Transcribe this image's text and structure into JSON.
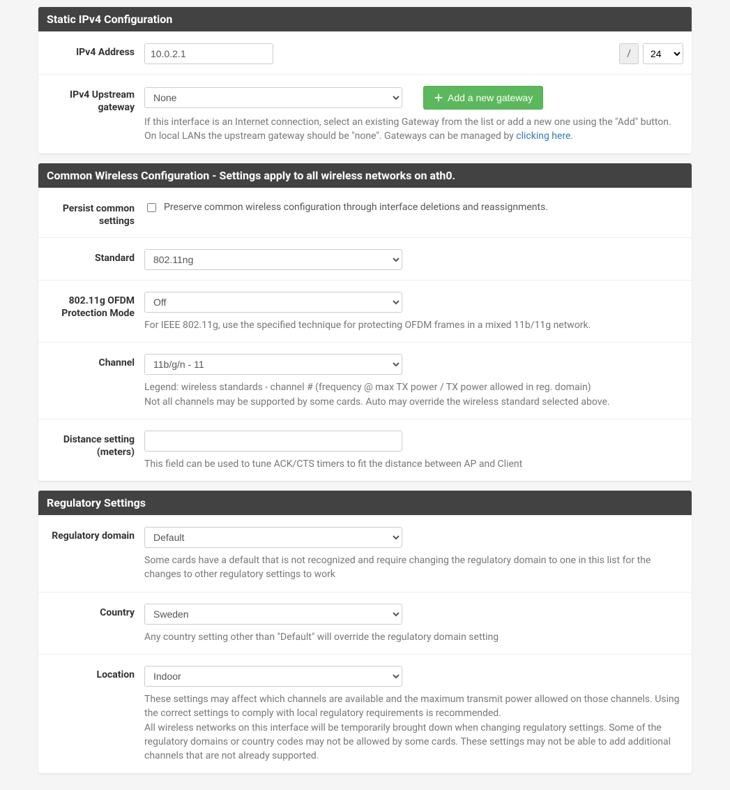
{
  "static_ipv4": {
    "header": "Static IPv4 Configuration",
    "addr_label": "IPv4 Address",
    "addr_value": "10.0.2.1",
    "slash": "/",
    "mask": "24",
    "gw_label": "IPv4 Upstream gateway",
    "gw_value": "None",
    "add_gw_btn": "Add a new gateway",
    "gw_help_a": "If this interface is an Internet connection, select an existing Gateway from the list or add a new one using the \"Add\" button.",
    "gw_help_b": "On local LANs the upstream gateway should be \"none\". Gateways can be managed by ",
    "gw_help_link": "clicking here"
  },
  "wireless": {
    "header": "Common Wireless Configuration - Settings apply to all wireless networks on ath0.",
    "persist_label": "Persist common settings",
    "persist_text": "Preserve common wireless configuration through interface deletions and reassignments.",
    "standard_label": "Standard",
    "standard_value": "802.11ng",
    "ofdm_label": "802.11g OFDM Protection Mode",
    "ofdm_value": "Off",
    "ofdm_help": "For IEEE 802.11g, use the specified technique for protecting OFDM frames in a mixed 11b/11g network.",
    "channel_label": "Channel",
    "channel_value": "11b/g/n - 11",
    "channel_help_a": "Legend: wireless standards - channel # (frequency @ max TX power / TX power allowed in reg. domain)",
    "channel_help_b": "Not all channels may be supported by some cards. Auto may override the wireless standard selected above.",
    "distance_label": "Distance setting (meters)",
    "distance_value": "",
    "distance_help": "This field can be used to tune ACK/CTS timers to fit the distance between AP and Client"
  },
  "reg": {
    "header": "Regulatory Settings",
    "domain_label": "Regulatory domain",
    "domain_value": "Default",
    "domain_help": "Some cards have a default that is not recognized and require changing the regulatory domain to one in this list for the changes to other regulatory settings to work",
    "country_label": "Country",
    "country_value": "Sweden",
    "country_help": "Any country setting other than \"Default\" will override the regulatory domain setting",
    "location_label": "Location",
    "location_value": "Indoor",
    "location_help_a": "These settings may affect which channels are available and the maximum transmit power allowed on those channels. Using the correct settings to comply with local regulatory requirements is recommended.",
    "location_help_b": "All wireless networks on this interface will be temporarily brought down when changing regulatory settings. Some of the regulatory domains or country codes may not be allowed by some cards. These settings may not be able to add additional channels that are not already supported."
  }
}
